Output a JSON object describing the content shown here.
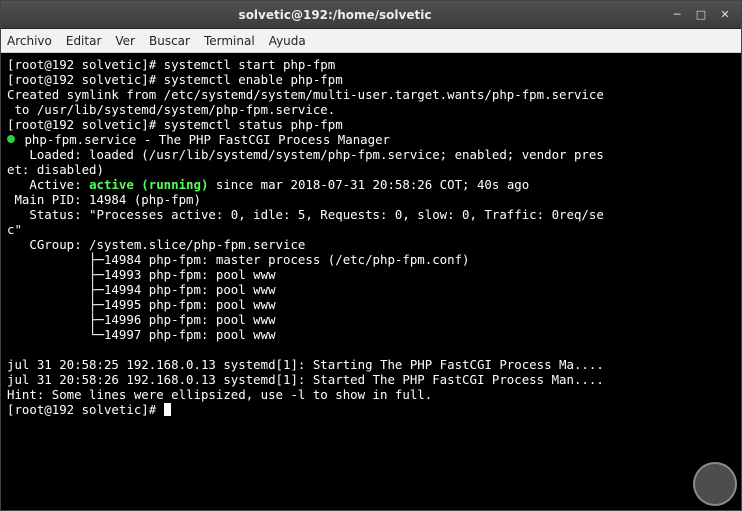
{
  "window": {
    "title": "solvetic@192:/home/solvetic"
  },
  "menu": {
    "archivo": "Archivo",
    "editar": "Editar",
    "ver": "Ver",
    "buscar": "Buscar",
    "terminal": "Terminal",
    "ayuda": "Ayuda"
  },
  "term": {
    "prompt1": "[root@192 solvetic]# ",
    "cmd1": "systemctl start php-fpm",
    "prompt2": "[root@192 solvetic]# ",
    "cmd2": "systemctl enable php-fpm",
    "line3": "Created symlink from /etc/systemd/system/multi-user.target.wants/php-fpm.service",
    "line4": " to /usr/lib/systemd/system/php-fpm.service.",
    "prompt5": "[root@192 solvetic]# ",
    "cmd5": "systemctl status php-fpm",
    "line6": " php-fpm.service - The PHP FastCGI Process Manager",
    "line7": "   Loaded: loaded (/usr/lib/systemd/system/php-fpm.service; enabled; vendor pres",
    "line8": "et: disabled)",
    "line9a": "   Active: ",
    "line9b": "active (running)",
    "line9c": " since mar 2018-07-31 20:58:26 COT; 40s ago",
    "line10": " Main PID: 14984 (php-fpm)",
    "line11": "   Status: \"Processes active: 0, idle: 5, Requests: 0, slow: 0, Traffic: 0req/se",
    "line12": "c\"",
    "line13": "   CGroup: /system.slice/php-fpm.service",
    "line14": "           ├─14984 php-fpm: master process (/etc/php-fpm.conf)",
    "line15": "           ├─14993 php-fpm: pool www",
    "line16": "           ├─14994 php-fpm: pool www",
    "line17": "           ├─14995 php-fpm: pool www",
    "line18": "           ├─14996 php-fpm: pool www",
    "line19": "           └─14997 php-fpm: pool www",
    "blank": "",
    "line20": "jul 31 20:58:25 192.168.0.13 systemd[1]: Starting The PHP FastCGI Process Ma....",
    "line21": "jul 31 20:58:26 192.168.0.13 systemd[1]: Started The PHP FastCGI Process Man....",
    "line22": "Hint: Some lines were ellipsized, use -l to show in full.",
    "prompt23": "[root@192 solvetic]# "
  }
}
